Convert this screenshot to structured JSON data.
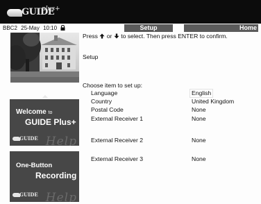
{
  "header": {
    "logo_text": "GUIDE",
    "logo_plus": "plus+"
  },
  "status": {
    "channel": "BBC2",
    "date": "25-May",
    "time": "10:10"
  },
  "tabs": [
    {
      "label": "Setup"
    },
    {
      "label": "Home"
    }
  ],
  "instruction": {
    "press": "Press",
    "or": "or",
    "rest": "to select. Then press ENTER to confirm."
  },
  "section_title": "Setup",
  "choose_label": "Choose item to set up:",
  "settings": [
    {
      "label": "Language",
      "value": "English",
      "selected": true
    },
    {
      "label": "Country",
      "value": "United Kingdom"
    },
    {
      "label": "Postal Code",
      "value": "None"
    },
    {
      "label": "External Receiver 1",
      "value": "None"
    },
    {
      "label": "External Receiver 2",
      "value": "None"
    },
    {
      "label": "External Receiver 3",
      "value": "None"
    }
  ],
  "panels": [
    {
      "line1": "Welcome",
      "line1_suffix": "to",
      "line2": "GUIDE Plus+",
      "help": "Help",
      "logo": "GUIDE"
    },
    {
      "line1": "One-Button",
      "line2": "Recording",
      "help": "Help",
      "logo": "GUIDE"
    }
  ],
  "colors": {
    "top_bar": "#0c0c0c",
    "tab_background": "#5b5b5b",
    "panel_background": "#474747",
    "page_background": "#fdfdfd"
  },
  "icons": [
    "lock-icon",
    "up-arrow-icon",
    "down-arrow-icon",
    "panel-up-arrow-icon"
  ]
}
